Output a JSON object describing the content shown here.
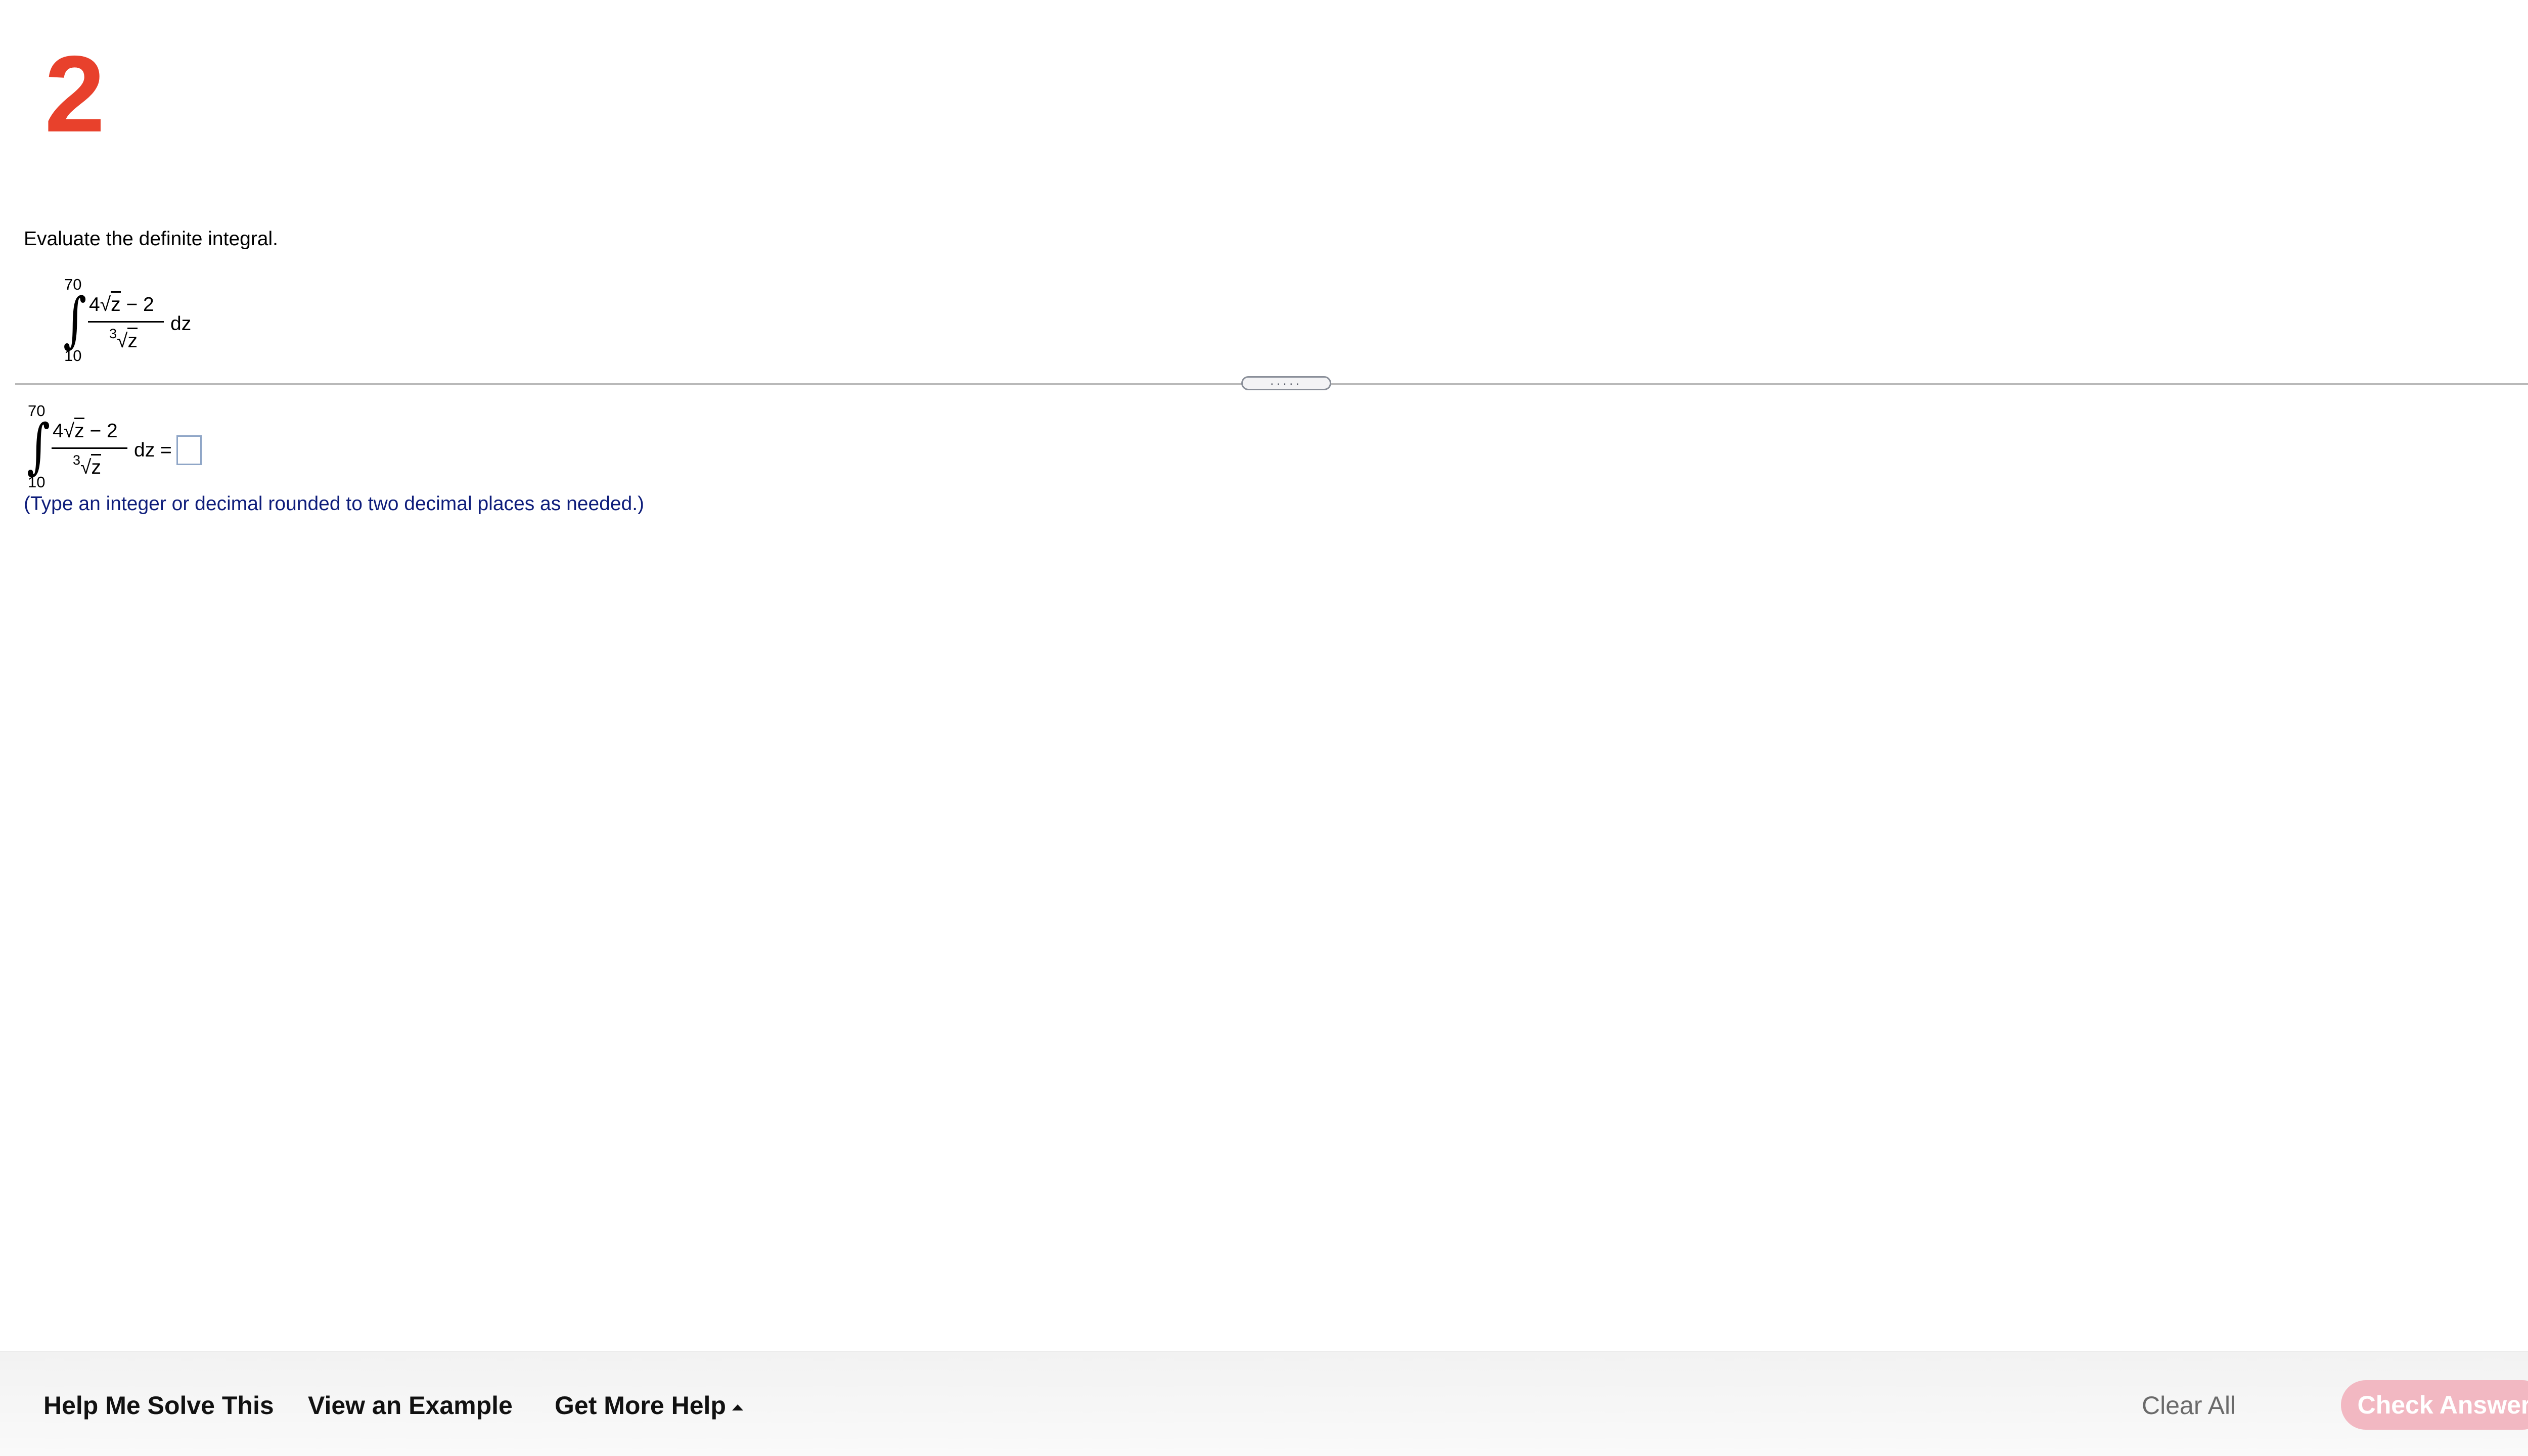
{
  "question": {
    "number": "2",
    "instruction": "Evaluate the definite integral.",
    "integral": {
      "upper": "70",
      "lower": "10",
      "numerator_coef": "4",
      "numerator_var": "z",
      "numerator_rest": " − 2",
      "root_index": "3",
      "denominator_var": "z",
      "differential": "dz"
    }
  },
  "answer": {
    "equals": "dz =",
    "value": "",
    "hint": "(Type an integer or decimal rounded to two decimal places as needed.)"
  },
  "divider": {
    "handle": "....."
  },
  "footer": {
    "help_me_solve": "Help Me Solve This",
    "view_example": "View an Example",
    "get_more_help": "Get More Help",
    "clear_all": "Clear All",
    "check_answer": "Check Answer"
  },
  "colors": {
    "question_number": "#e8412c",
    "hint_text": "#0d1c7a",
    "check_button": "#f2b8c2"
  }
}
